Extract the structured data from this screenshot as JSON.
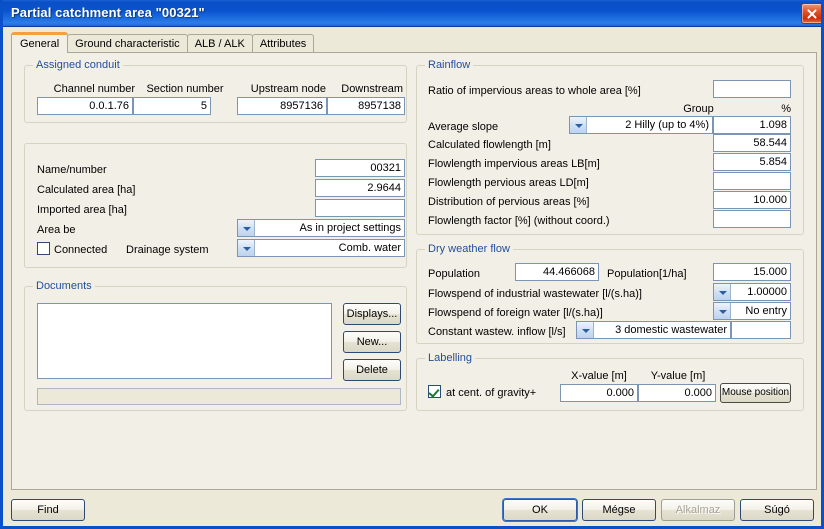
{
  "window": {
    "title": "Partial catchment area \"00321\"",
    "close_icon": "close-icon"
  },
  "tabs": [
    {
      "label": "General",
      "active": true
    },
    {
      "label": "Ground characteristic",
      "active": false
    },
    {
      "label": "ALB / ALK",
      "active": false
    },
    {
      "label": "Attributes",
      "active": false
    }
  ],
  "assigned_conduit": {
    "legend": "Assigned conduit",
    "headers": {
      "channel_number": "Channel number",
      "section_number": "Section number",
      "upstream_node": "Upstream node",
      "downstream": "Downstream"
    },
    "values": {
      "channel_number": "0.0.1.76",
      "section_number": "5",
      "upstream_node": "8957136",
      "downstream": "8957138"
    }
  },
  "identification": {
    "labels": {
      "name_number": "Name/number",
      "calculated_area": "Calculated area [ha]",
      "imported_area": "Imported area [ha]",
      "area_be": "Area be",
      "connected": "Connected",
      "drainage_system": "Drainage system"
    },
    "values": {
      "name_number": "00321",
      "calculated_area": "2.9644",
      "imported_area": "",
      "area_be": "As in project settings",
      "drainage_system": "Comb. water",
      "connected_checked": false
    }
  },
  "documents": {
    "legend": "Documents",
    "list_items": [],
    "buttons": {
      "displays": "Displays...",
      "new": "New...",
      "delete": "Delete"
    },
    "status_text": ""
  },
  "rainflow": {
    "legend": "Rainflow",
    "labels": {
      "ratio_impervious": "Ratio of impervious areas to whole area [%]",
      "group": "Group",
      "percent": "%",
      "average_slope": "Average slope",
      "calculated_flowlength": "Calculated flowlength [m]",
      "flowlength_impervious": "Flowlength impervious areas LB[m]",
      "flowlength_pervious": "Flowlength pervious areas LD[m]",
      "distribution_pervious": "Distribution of pervious areas [%]",
      "flowlength_factor": "Flowlength factor [%] (without coord.)"
    },
    "values": {
      "ratio_impervious": "",
      "average_slope_group": "2 Hilly (up to 4%)",
      "average_slope_percent": "1.098",
      "calculated_flowlength": "58.544",
      "flowlength_impervious": "5.854",
      "flowlength_pervious": "",
      "distribution_pervious": "10.000",
      "flowlength_factor": ""
    }
  },
  "dry_weather_flow": {
    "legend": "Dry weather flow",
    "labels": {
      "population": "Population",
      "population_per_ha": "Population[1/ha]",
      "industrial_wastewater": "Flowspend of industrial wastewater [l/(s.ha)]",
      "foreign_water": "Flowspend of foreign water [l/(s.ha)]",
      "constant_inflow": "Constant wastew. inflow [l/s]"
    },
    "values": {
      "population": "44.466068",
      "population_per_ha": "15.000",
      "industrial_wastewater": "1.00000",
      "foreign_water": "No entry",
      "constant_inflow_type": "3 domestic wastewater",
      "constant_inflow_value": ""
    }
  },
  "labelling": {
    "legend": "Labelling",
    "labels": {
      "x_value": "X-value [m]",
      "y_value": "Y-value [m]",
      "at_cent_gravity": "at cent. of gravity+"
    },
    "values": {
      "x_value": "0.000",
      "y_value": "0.000",
      "at_cent_gravity_checked": true
    },
    "buttons": {
      "mouse_position": "Mouse position"
    }
  },
  "footer": {
    "find": "Find",
    "ok": "OK",
    "cancel": "Mégse",
    "apply": "Alkalmaz",
    "help": "Súgó"
  },
  "colors": {
    "titlebar_blue": "#0a52ce",
    "dialog_bg": "#ece9d8",
    "panel_bg": "#f2f0e6",
    "legend_text": "#1f4e9c",
    "active_tab_accent": "#f0a33c",
    "field_border": "#7a96b4"
  }
}
